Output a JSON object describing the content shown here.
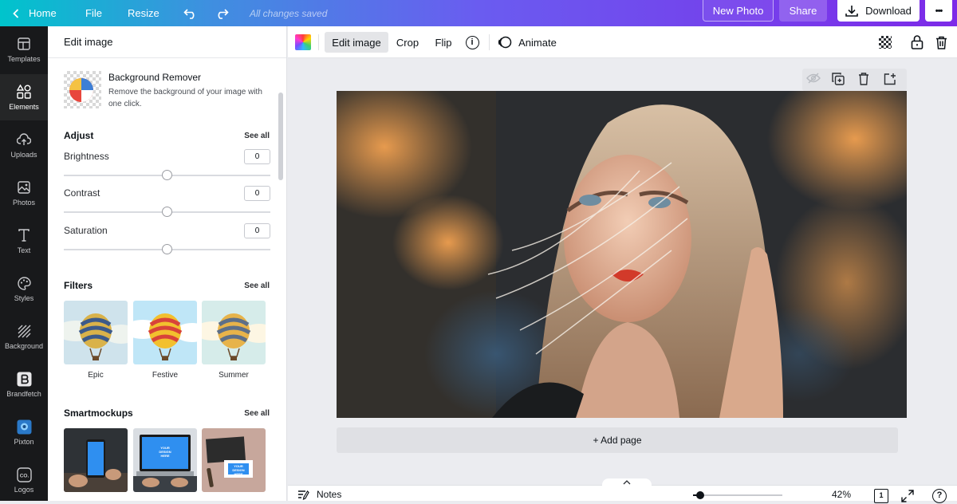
{
  "topbar": {
    "home_label": "Home",
    "file_label": "File",
    "resize_label": "Resize",
    "saved_status": "All changes saved",
    "new_photo_label": "New Photo",
    "share_label": "Share",
    "download_label": "Download",
    "more_label": "•••"
  },
  "sidebar": {
    "items": [
      {
        "label": "Templates",
        "icon": "templates-icon"
      },
      {
        "label": "Elements",
        "icon": "elements-icon"
      },
      {
        "label": "Uploads",
        "icon": "uploads-icon"
      },
      {
        "label": "Photos",
        "icon": "photos-icon"
      },
      {
        "label": "Text",
        "icon": "text-icon"
      },
      {
        "label": "Styles",
        "icon": "styles-icon"
      },
      {
        "label": "Background",
        "icon": "background-icon"
      },
      {
        "label": "Brandfetch",
        "icon": "brandfetch-icon"
      },
      {
        "label": "Pixton",
        "icon": "pixton-icon"
      },
      {
        "label": "Logos",
        "icon": "logos-icon"
      }
    ],
    "active_index": 1
  },
  "panel": {
    "title": "Edit image",
    "bg_remover": {
      "title": "Background Remover",
      "description": "Remove the background of your image with one click."
    },
    "adjust": {
      "heading": "Adjust",
      "see_all": "See all",
      "brightness_label": "Brightness",
      "brightness_value": "0",
      "contrast_label": "Contrast",
      "contrast_value": "0",
      "saturation_label": "Saturation",
      "saturation_value": "0"
    },
    "filters": {
      "heading": "Filters",
      "see_all": "See all",
      "items": [
        {
          "label": "Epic"
        },
        {
          "label": "Festive"
        },
        {
          "label": "Summer"
        }
      ]
    },
    "smartmockups": {
      "heading": "Smartmockups",
      "see_all": "See all",
      "mock_text": "YOUR DESIGN HERE"
    }
  },
  "toolbar": {
    "edit_image_label": "Edit image",
    "crop_label": "Crop",
    "flip_label": "Flip",
    "info_symbol": "i",
    "animate_label": "Animate"
  },
  "canvas": {
    "add_page_label": "+ Add page"
  },
  "bottombar": {
    "notes_label": "Notes",
    "zoom_value": "42%",
    "page_number": "1",
    "help_symbol": "?"
  },
  "colors": {
    "accent": "#7d2ae8",
    "teal": "#00c4cc",
    "sidebar_bg": "#18191b"
  }
}
